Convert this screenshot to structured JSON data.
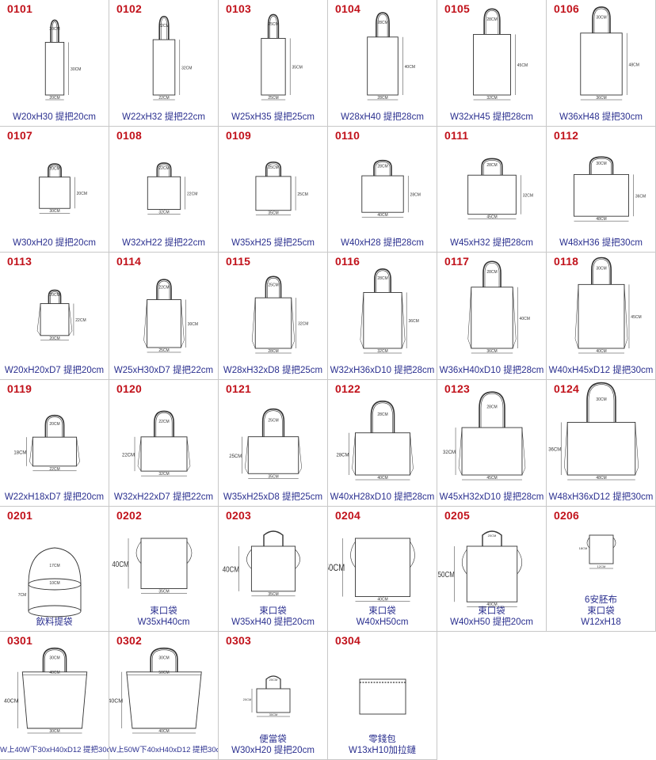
{
  "items": [
    {
      "code": "0101",
      "lines": [
        "W20xH30 提把20cm"
      ],
      "dims": {
        "handle": "20CM",
        "h": "30CM",
        "w": "20CM"
      }
    },
    {
      "code": "0102",
      "lines": [
        "W22xH32 提把22cm"
      ],
      "dims": {
        "handle": "22CM",
        "h": "32CM",
        "w": "22CM"
      }
    },
    {
      "code": "0103",
      "lines": [
        "W25xH35 提把25cm"
      ],
      "dims": {
        "handle": "25CM",
        "h": "35CM",
        "w": "25CM"
      }
    },
    {
      "code": "0104",
      "lines": [
        "W28xH40 提把28cm"
      ],
      "dims": {
        "handle": "28CM",
        "h": "40CM",
        "w": "28CM"
      }
    },
    {
      "code": "0105",
      "lines": [
        "W32xH45 提把28cm"
      ],
      "dims": {
        "handle": "28CM",
        "h": "45CM",
        "w": "32CM"
      }
    },
    {
      "code": "0106",
      "lines": [
        "W36xH48 提把30cm"
      ],
      "dims": {
        "handle": "30CM",
        "h": "48CM",
        "w": "36CM"
      }
    },
    {
      "code": "0107",
      "lines": [
        "W30xH20 提把20cm"
      ],
      "dims": {
        "handle": "20CM",
        "h": "20CM",
        "w": "30CM"
      }
    },
    {
      "code": "0108",
      "lines": [
        "W32xH22 提把22cm"
      ],
      "dims": {
        "handle": "22CM",
        "h": "22CM",
        "w": "32CM"
      }
    },
    {
      "code": "0109",
      "lines": [
        "W35xH25 提把25cm"
      ],
      "dims": {
        "handle": "25CM",
        "h": "25CM",
        "w": "35CM"
      }
    },
    {
      "code": "0110",
      "lines": [
        "W40xH28 提把28cm"
      ],
      "dims": {
        "handle": "28CM",
        "h": "28CM",
        "w": "40CM"
      }
    },
    {
      "code": "0111",
      "lines": [
        "W45xH32 提把28cm"
      ],
      "dims": {
        "handle": "28CM",
        "h": "32CM",
        "w": "45CM"
      }
    },
    {
      "code": "0112",
      "lines": [
        "W48xH36 提把30cm"
      ],
      "dims": {
        "handle": "30CM",
        "h": "36CM",
        "w": "48CM"
      }
    },
    {
      "code": "0113",
      "lines": [
        "W20xH20xD7 提把20cm"
      ],
      "dims": {
        "handle": "20CM",
        "h": "22CM",
        "w": "20CM"
      }
    },
    {
      "code": "0114",
      "lines": [
        "W25xH30xD7 提把22cm"
      ],
      "dims": {
        "handle": "22CM",
        "h": "30CM",
        "w": "25CM"
      }
    },
    {
      "code": "0115",
      "lines": [
        "W28xH32xD8 提把25cm"
      ],
      "dims": {
        "handle": "25CM",
        "h": "32CM",
        "w": "28CM"
      }
    },
    {
      "code": "0116",
      "lines": [
        "W32xH36xD10 提把28cm"
      ],
      "dims": {
        "handle": "28CM",
        "h": "36CM",
        "w": "32CM"
      }
    },
    {
      "code": "0117",
      "lines": [
        "W36xH40xD10 提把28cm"
      ],
      "dims": {
        "handle": "28CM",
        "h": "40CM",
        "w": "36CM"
      }
    },
    {
      "code": "0118",
      "lines": [
        "W40xH45xD12 提把30cm"
      ],
      "dims": {
        "handle": "30CM",
        "h": "45CM",
        "w": "40CM"
      }
    },
    {
      "code": "0119",
      "lines": [
        "W22xH18xD7 提把20cm"
      ],
      "dims": {
        "handle": "20CM",
        "h": "18CM",
        "w": "22CM"
      }
    },
    {
      "code": "0120",
      "lines": [
        "W32xH22xD7 提把22cm"
      ],
      "dims": {
        "handle": "22CM",
        "h": "22CM",
        "w": "32CM"
      }
    },
    {
      "code": "0121",
      "lines": [
        "W35xH25xD8 提把25cm"
      ],
      "dims": {
        "handle": "25CM",
        "h": "25CM",
        "w": "35CM"
      }
    },
    {
      "code": "0122",
      "lines": [
        "W40xH28xD10 提把28cm"
      ],
      "dims": {
        "handle": "28CM",
        "h": "28CM",
        "w": "40CM"
      }
    },
    {
      "code": "0123",
      "lines": [
        "W45xH32xD10 提把28cm"
      ],
      "dims": {
        "handle": "28CM",
        "h": "32CM",
        "w": "45CM"
      }
    },
    {
      "code": "0124",
      "lines": [
        "W48xH36xD12 提把30cm"
      ],
      "dims": {
        "handle": "30CM",
        "h": "36CM",
        "w": "48CM"
      }
    },
    {
      "code": "0201",
      "lines": [
        "飲料提袋"
      ],
      "dims": {
        "handle": "17CM",
        "h": "7CM",
        "w": "10CM"
      }
    },
    {
      "code": "0202",
      "lines": [
        "束口袋",
        "W35xH40cm"
      ],
      "dims": {
        "handle": "",
        "h": "40CM",
        "w": "35CM"
      }
    },
    {
      "code": "0203",
      "lines": [
        "束口袋",
        "W35xH40 提把20cm"
      ],
      "dims": {
        "handle": "",
        "h": "40CM",
        "w": "35CM"
      }
    },
    {
      "code": "0204",
      "lines": [
        "束口袋",
        "W40xH50cm"
      ],
      "dims": {
        "handle": "",
        "h": "50CM",
        "w": "40CM"
      }
    },
    {
      "code": "0205",
      "lines": [
        "束口袋",
        "W40xH50 提把20cm"
      ],
      "dims": {
        "handle": "20CM",
        "h": "50CM",
        "w": "40CM"
      }
    },
    {
      "code": "0206",
      "lines": [
        "6安胚布",
        "束口袋",
        "W12xH18"
      ],
      "dims": {
        "handle": "",
        "h": "18CM",
        "w": "12CM"
      }
    },
    {
      "code": "0301",
      "lines": [
        "W上40W下30xH40xD12 提把30cm"
      ],
      "dims": {
        "handle": "30CM",
        "h": "40CM",
        "w": "30CM",
        "top": "40CM"
      }
    },
    {
      "code": "0302",
      "lines": [
        "W上50W下40xH40xD12 提把30cm"
      ],
      "dims": {
        "handle": "30CM",
        "h": "40CM",
        "w": "40CM",
        "top": "50CM"
      }
    },
    {
      "code": "0303",
      "lines": [
        "便當袋",
        "W30xH20 提把20cm"
      ],
      "dims": {
        "handle": "20CM",
        "h": "20CM",
        "w": "30CM"
      }
    },
    {
      "code": "0304",
      "lines": [
        "零錢包",
        "W13xH10加拉鏈"
      ],
      "dims": {
        "handle": "",
        "h": "",
        "w": ""
      }
    }
  ]
}
